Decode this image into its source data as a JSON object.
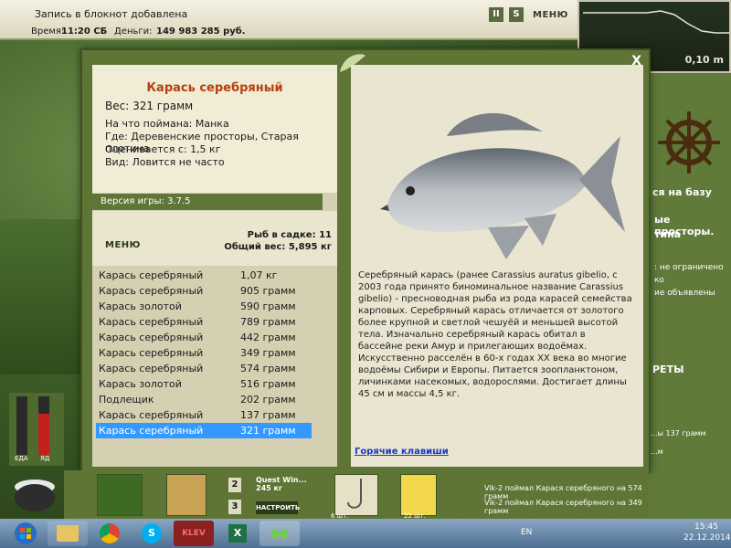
{
  "status": {
    "message": "Запись в блокнот добавлена",
    "time_label": "Время:",
    "time_value": "11:20 СБ",
    "money_label": "Деньги:",
    "money_value": "149 983 285 руб.",
    "pause_label": "II",
    "sound_label": "S",
    "menu_label": "МЕНЮ",
    "minimize_label": "—"
  },
  "depth": {
    "value": "0,10 m"
  },
  "modal": {
    "close_label": "X",
    "fish": {
      "name": "Карась серебряный",
      "weight": "Вес: 321 грамм",
      "bait": "На что поймана: Манка",
      "place": "Где: Деревенские просторы, Старая плотина",
      "value": "Оценивается с: 1,5 кг",
      "type": "Вид: Ловится не часто"
    },
    "version": "Версия игры: 3.7.5",
    "menu_label": "МЕНЮ",
    "catch_count": "Рыб в садке: 11",
    "total_weight": "Общий вес: 5,895 кг",
    "catch_list": [
      {
        "name": "Карась серебряный",
        "weight": "1,07 кг"
      },
      {
        "name": "Карась серебряный",
        "weight": "905 грамм"
      },
      {
        "name": "Карась золотой",
        "weight": "590 грамм"
      },
      {
        "name": "Карась серебряный",
        "weight": "789 грамм"
      },
      {
        "name": "Карась серебряный",
        "weight": "442 грамм"
      },
      {
        "name": "Карась серебряный",
        "weight": "349 грамм"
      },
      {
        "name": "Карась серебряный",
        "weight": "574 грамм"
      },
      {
        "name": "Карась золотой",
        "weight": "516 грамм"
      },
      {
        "name": "Подлещик",
        "weight": "202 грамм"
      },
      {
        "name": "Карась серебряный",
        "weight": "137 грамм"
      },
      {
        "name": "Карась серебряный",
        "weight": "321 грамм"
      }
    ],
    "selected_index": 10,
    "description": "Серебряный карась (ранее Carassius auratus gibelio, с 2003 года принято биноминальное название Carassius gibelio) - пресноводная рыба из рода карасей семейства карповых. Серебряный карась отличается от золотого более крупной и светлой чешуёй и меньшей высотой тела. Изначально серебряный карась обитал в бассейне реки Амур и прилегающих водоёмах. Искусственно расселён в 60-х годах XX века во многие водоёмы Сибири и Европы. Питается зоопланктоном, личинками насекомых, водорослями. Достигает длины 45 см и массы 4,5 кг.",
    "hotkeys_label": "Горячие клавиши"
  },
  "right_panel": {
    "base_label": "ся на базу",
    "place_line1": "ые просторы.",
    "place_line2": "тина",
    "info_line1": ": не ограничено",
    "info_line2": "ко",
    "info_line3": "ие объявлены",
    "secrets_label": "РЕТЫ"
  },
  "gauges": {
    "food_label": "ЕДА",
    "poison_label": "ЯД",
    "food_level": 0.0,
    "poison_level": 0.7
  },
  "strip": {
    "slot_2": "2",
    "slot_3": "3",
    "quest_label": "Quest Win...",
    "quest_weight": "245 кг",
    "setup_label": "НАСТРОИТЬ",
    "count_left": "6 шт.",
    "count_right": "22 шт."
  },
  "chat": [
    "...ы 137 грамм",
    "...м",
    "Vik-2 поймал Карася серебряного на 574 грамм",
    "Vik-2 поймал Карася серебряного на 349 грамм"
  ],
  "taskbar": {
    "lang": "EN",
    "time": "15:45",
    "date": "22.12.2014",
    "klev_label": "KLEV"
  },
  "colors": {
    "panel_green": "#5e7535",
    "title_red": "#b5400e",
    "selection": "#3399ff"
  }
}
